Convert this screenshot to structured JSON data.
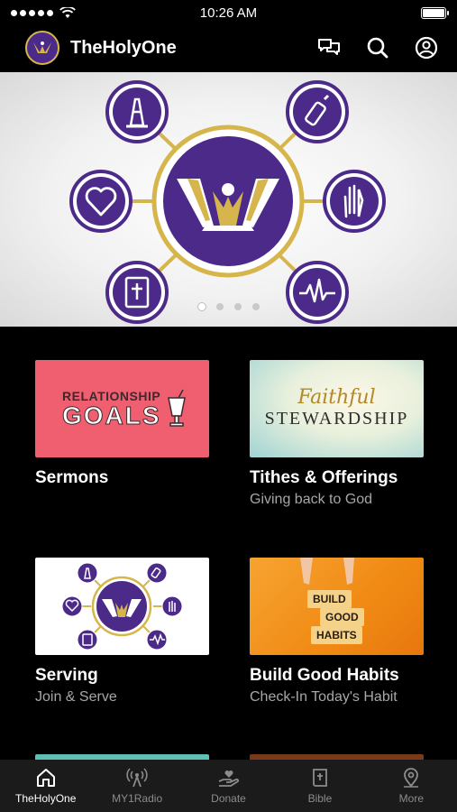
{
  "status_bar": {
    "time": "10:26 AM",
    "battery_level": 1.0
  },
  "header": {
    "title": "TheHolyOne",
    "icons": [
      "chat-icon",
      "search-icon",
      "profile-icon"
    ]
  },
  "hero": {
    "slide_count": 4,
    "active_slide": 1,
    "icons": [
      "traffic-cone-icon",
      "baby-bottle-icon",
      "heart-icon",
      "raised-hand-icon",
      "bible-icon",
      "heartbeat-icon"
    ]
  },
  "cards": [
    {
      "title": "Sermons",
      "subtitle": "",
      "thumb_text": {
        "top": "RELATIONSHIP",
        "main": "GOALS"
      }
    },
    {
      "title": "Tithes & Offerings",
      "subtitle": "Giving back to God",
      "thumb_text": {
        "top": "Faithful",
        "main": "STEWARDSHIP"
      }
    },
    {
      "title": "Serving",
      "subtitle": "Join & Serve"
    },
    {
      "title": "Build Good Habits",
      "subtitle": "Check-In Today's Habit",
      "thumb_text": {
        "line1": "BUILD",
        "line2": "GOOD",
        "line3": "HABITS"
      }
    }
  ],
  "tabs": [
    {
      "label": "TheHolyOne",
      "icon": "home-icon",
      "active": true
    },
    {
      "label": "MY1Radio",
      "icon": "radio-tower-icon",
      "active": false
    },
    {
      "label": "Donate",
      "icon": "donate-hand-icon",
      "active": false
    },
    {
      "label": "Bible",
      "icon": "bible-icon",
      "active": false
    },
    {
      "label": "More",
      "icon": "map-pin-icon",
      "active": false
    }
  ],
  "colors": {
    "brand_purple": "#4b2a8a",
    "brand_gold": "#d6b64c",
    "background": "#000000",
    "tab_bar": "#1b1b1b"
  }
}
